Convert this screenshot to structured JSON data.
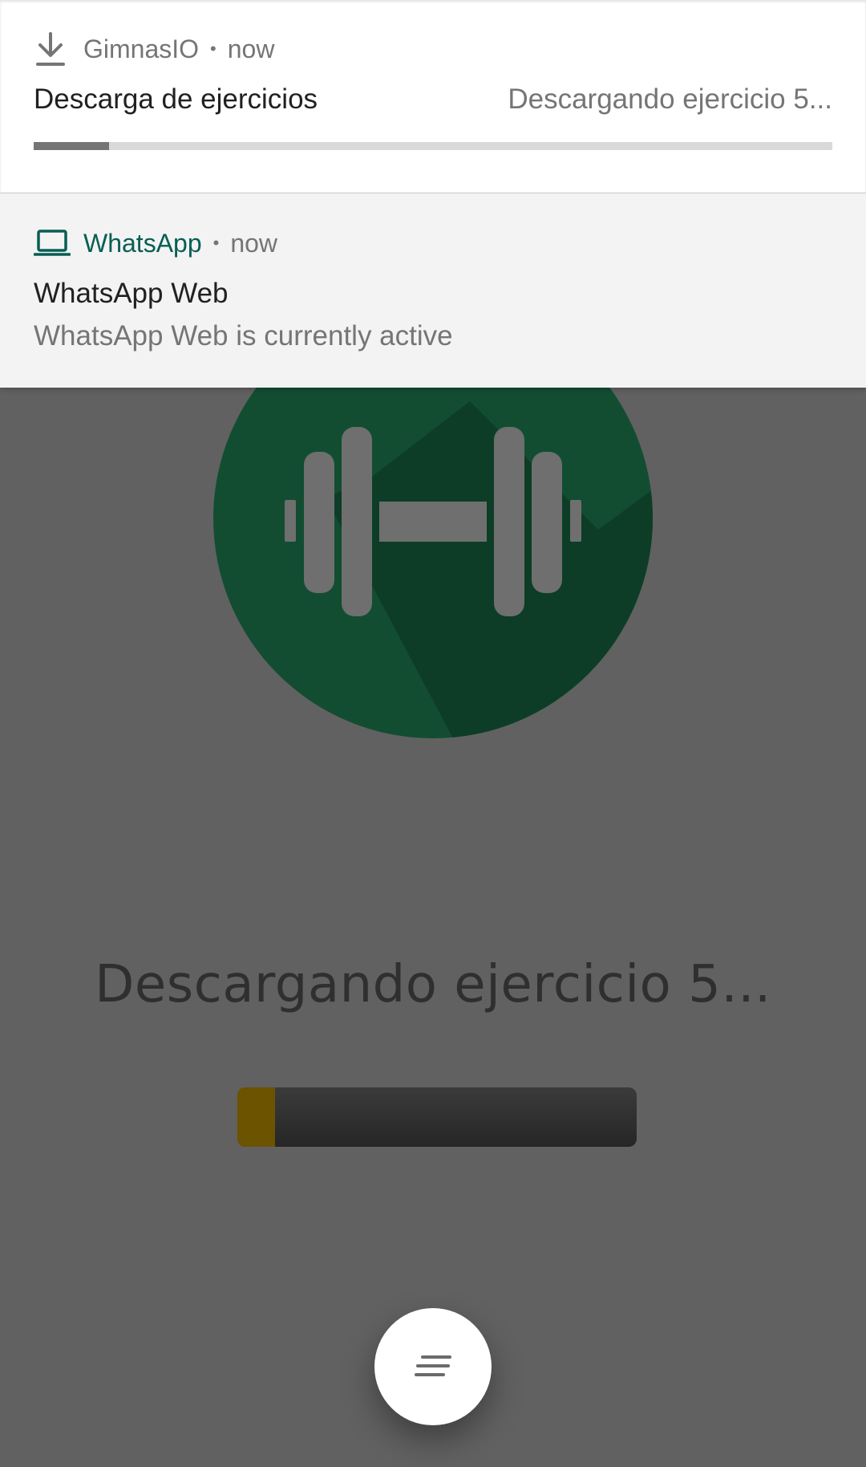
{
  "notifications": [
    {
      "app_name": "GimnasIO",
      "time": "now",
      "icon": "download-icon",
      "title": "Descarga de ejercicios",
      "content": "Descargando ejercicio 5...",
      "progress": 0.094
    },
    {
      "app_name": "WhatsApp",
      "time": "now",
      "icon": "laptop-icon",
      "title": "WhatsApp Web",
      "text": "WhatsApp Web is currently active",
      "accent": "#075e54"
    }
  ],
  "app": {
    "logo_icon": "dumbbell-icon",
    "logo_color": "#124d32",
    "status_text": "Descargando ejercicio 5...",
    "progress": 0.094,
    "progress_color": "#6b5300",
    "fab_icon": "notes-icon"
  },
  "separator_dot": "•"
}
